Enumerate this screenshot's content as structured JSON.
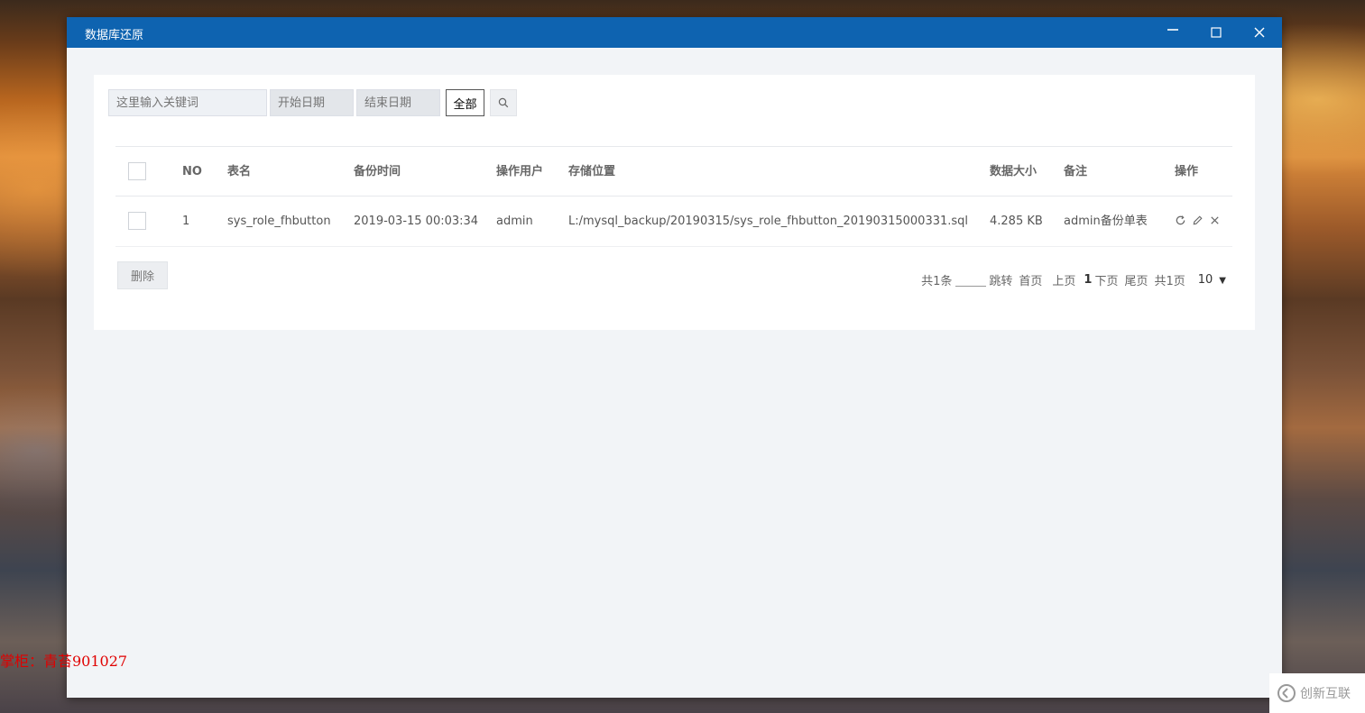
{
  "window": {
    "title": "数据库还原",
    "controls": {
      "minimize": "minimize",
      "maximize": "maximize",
      "close": "close"
    }
  },
  "search": {
    "keyword_placeholder": "这里输入关键词",
    "start_date_placeholder": "开始日期",
    "end_date_placeholder": "结束日期",
    "type_select_value": "全部",
    "search_icon": "search-icon"
  },
  "table": {
    "headers": {
      "no": "NO",
      "table_name": "表名",
      "backup_time": "备份时间",
      "operator": "操作用户",
      "location": "存储位置",
      "size": "数据大小",
      "note": "备注",
      "actions": "操作"
    },
    "rows": [
      {
        "no": "1",
        "table_name": "sys_role_fhbutton",
        "backup_time": "2019-03-15 00:03:34",
        "operator": "admin",
        "location": "L:/mysql_backup/20190315/sys_role_fhbutton_20190315000331.sql",
        "size": "4.285 KB",
        "note": "admin备份单表",
        "action_icons": [
          "restore-icon",
          "edit-icon",
          "delete-icon"
        ]
      }
    ]
  },
  "footer": {
    "delete_label": "删除",
    "pagination": {
      "total": "共1条",
      "jump": "跳转",
      "first": "首页",
      "prev": "上页",
      "current": "1",
      "next": "下页",
      "last": "尾页",
      "pages": "共1页",
      "page_size": "10"
    }
  },
  "overlay": {
    "watermark": "掌柜：青苔901027",
    "brand": "创新互联"
  },
  "colors": {
    "titlebar": "#0e63b0",
    "watermark": "#e00000"
  }
}
